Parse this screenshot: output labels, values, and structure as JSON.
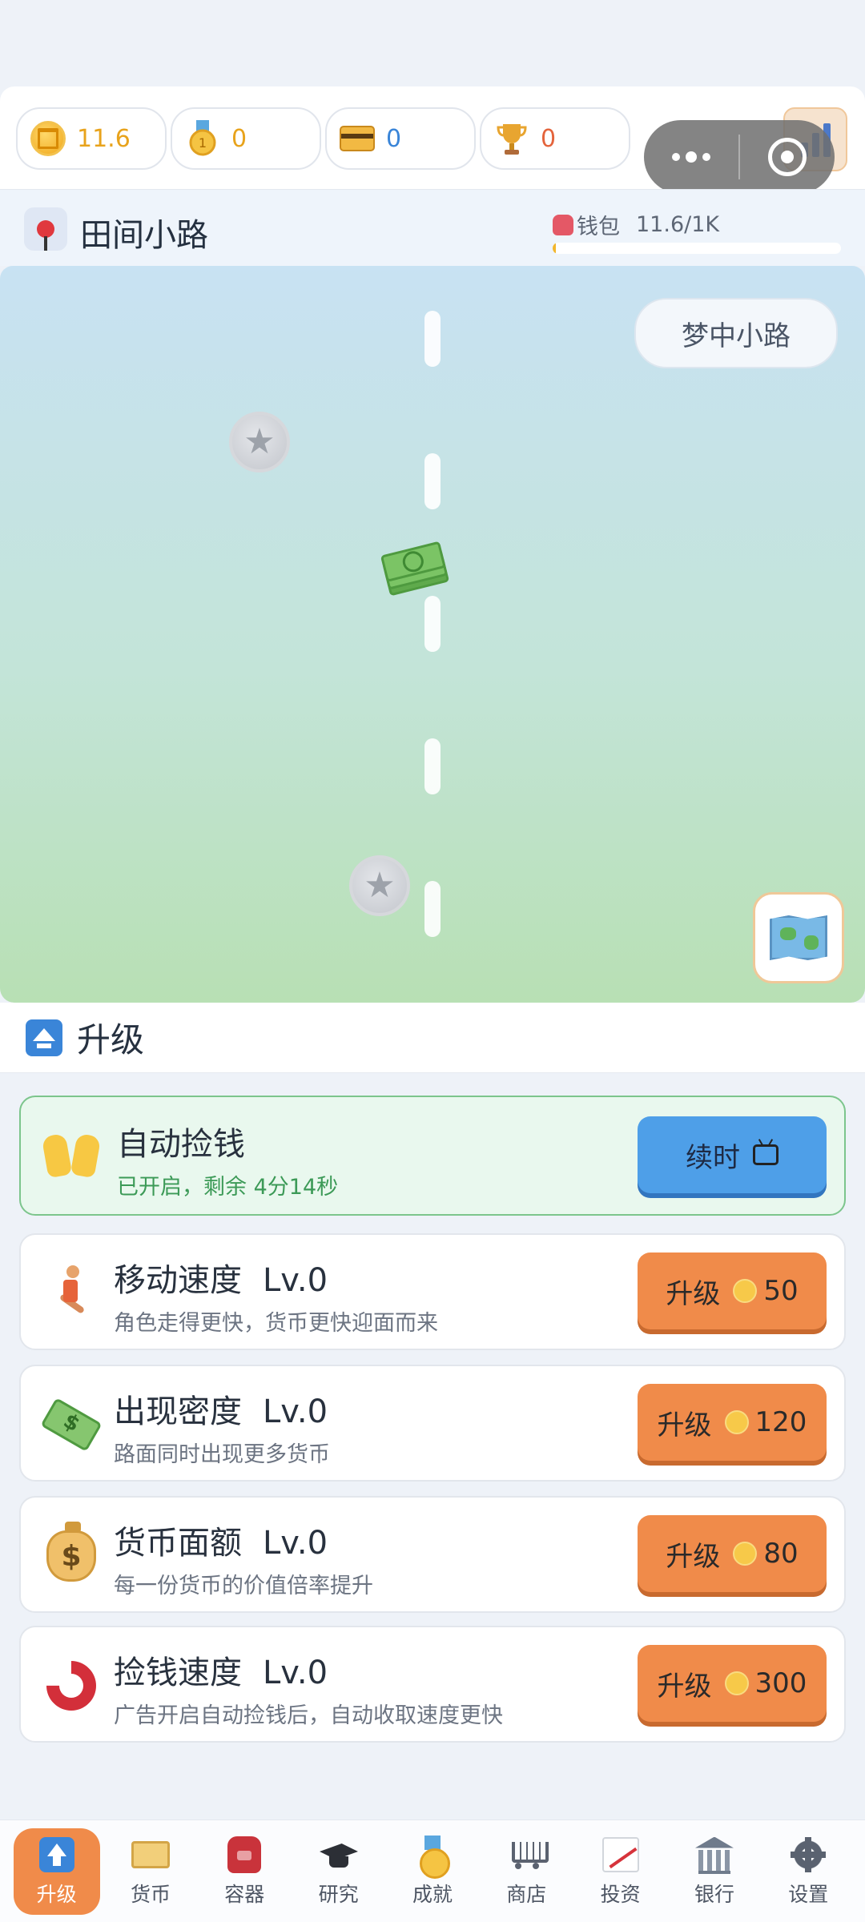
{
  "currencies": [
    {
      "icon": "bank-coin-icon",
      "value": "11.6",
      "color": "#e8a31c"
    },
    {
      "icon": "medal-icon",
      "value": "0",
      "color": "#e8a31c"
    },
    {
      "icon": "card-icon",
      "value": "0",
      "color": "#3a85d8"
    },
    {
      "icon": "trophy-icon",
      "value": "0",
      "color": "#e4643c"
    }
  ],
  "location": {
    "name": "田间小路",
    "wallet_label": "钱包",
    "wallet_value": "11.6/1K",
    "wallet_fill": 0.0116
  },
  "scene": {
    "dream_road_button": "梦中小路"
  },
  "section": {
    "title": "升级"
  },
  "upgrades": {
    "auto": {
      "title": "自动捡钱",
      "desc": "已开启，剩余 4分14秒",
      "button": "续时"
    },
    "items": [
      {
        "title": "移动速度",
        "level": "Lv.0",
        "desc": "角色走得更快，货币更快迎面而来",
        "button": "升级",
        "cost": "50"
      },
      {
        "title": "出现密度",
        "level": "Lv.0",
        "desc": "路面同时出现更多货币",
        "button": "升级",
        "cost": "120"
      },
      {
        "title": "货币面额",
        "level": "Lv.0",
        "desc": "每一份货币的价值倍率提升",
        "button": "升级",
        "cost": "80"
      },
      {
        "title": "捡钱速度",
        "level": "Lv.0",
        "desc": "广告开启自动捡钱后，自动收取速度更快",
        "button": "升级",
        "cost": "300"
      }
    ]
  },
  "nav": [
    {
      "label": "升级",
      "icon": "upgrade-icon",
      "active": true
    },
    {
      "label": "货币",
      "icon": "cash-icon",
      "active": false
    },
    {
      "label": "容器",
      "icon": "backpack-icon",
      "active": false
    },
    {
      "label": "研究",
      "icon": "graduation-cap-icon",
      "active": false
    },
    {
      "label": "成就",
      "icon": "medal-icon",
      "active": false
    },
    {
      "label": "商店",
      "icon": "cart-icon",
      "active": false
    },
    {
      "label": "投资",
      "icon": "chart-icon",
      "active": false
    },
    {
      "label": "银行",
      "icon": "bank-icon",
      "active": false
    },
    {
      "label": "设置",
      "icon": "gear-icon",
      "active": false
    }
  ]
}
